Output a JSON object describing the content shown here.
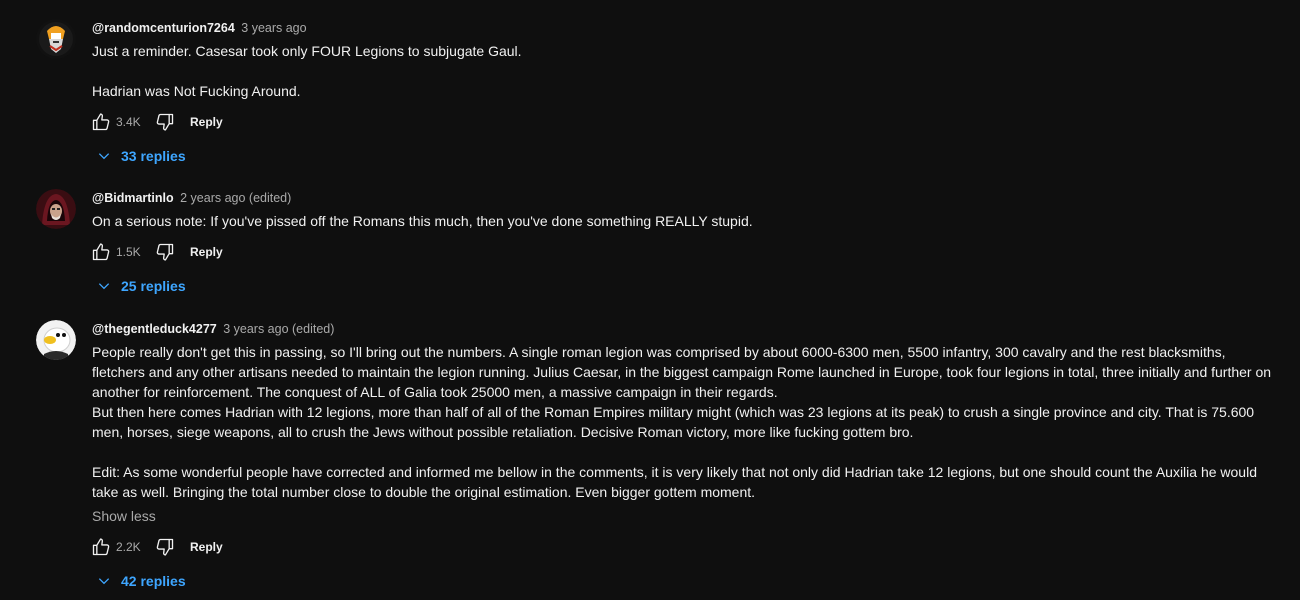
{
  "comments": [
    {
      "author": "@randomcenturion7264",
      "time": "3 years ago",
      "text": "Just a reminder. Casesar took only FOUR Legions to subjugate Gaul.\n\nHadrian was Not Fucking Around.",
      "likes": "3.4K",
      "reply_label": "Reply",
      "replies_label": "33 replies"
    },
    {
      "author": "@Bidmartinlo",
      "time": "2 years ago (edited)",
      "text": "On a serious note: If you've pissed off the Romans this much, then you've done something REALLY stupid.",
      "likes": "1.5K",
      "reply_label": "Reply",
      "replies_label": "25 replies"
    },
    {
      "author": "@thegentleduck4277",
      "time": "3 years ago (edited)",
      "text": "People really don't get this in passing, so I'll bring out the numbers. A single roman legion was comprised by about 6000-6300 men, 5500 infantry, 300 cavalry and the rest blacksmiths, fletchers and any other artisans needed to maintain the legion running. Julius Caesar, in the biggest campaign Rome launched in Europe, took four legions in total, three initially and further on another for reinforcement. The conquest of ALL of Galia took 25000 men, a massive campaign in their regards.\nBut then here comes Hadrian with 12 legions, more than half of all of the Roman Empires military might (which was 23 legions at its peak) to crush a single province and city. That is 75.600 men, horses, siege weapons, all to crush the Jews without possible retaliation. Decisive Roman victory, more like fucking gottem bro.\n\nEdit: As some wonderful people have corrected and informed me bellow in the comments, it is very likely that not only did Hadrian take 12 legions, but one should count the Auxilia he would take as well. Bringing the total number close to double the original estimation. Even bigger gottem moment.",
      "show_less": "Show less",
      "likes": "2.2K",
      "reply_label": "Reply",
      "replies_label": "42 replies"
    }
  ],
  "colors": {
    "background": "#0f0f0f",
    "text": "#f1f1f1",
    "secondary_text": "#aaaaaa",
    "link_blue": "#3ea6ff"
  },
  "icons": [
    "avatar-image",
    "thumbs-up-icon",
    "thumbs-down-icon",
    "chevron-down-icon"
  ]
}
